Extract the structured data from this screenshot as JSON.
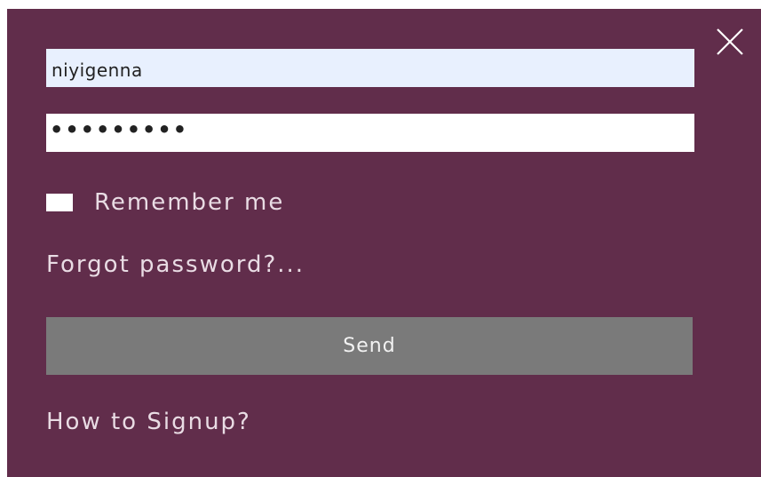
{
  "login_form": {
    "username_value": "niyigenna",
    "password_mask": "•••••••••",
    "remember_label": "Remember me",
    "remember_checked": false,
    "forgot_link": "Forgot password?...",
    "send_label": "Send",
    "signup_link": "How to Signup?"
  },
  "icons": {
    "close": "close-icon"
  },
  "colors": {
    "background": "#612d4b",
    "button": "#7a7a7a",
    "username_bg": "#e8f0fe",
    "text": "#e9dce4"
  }
}
